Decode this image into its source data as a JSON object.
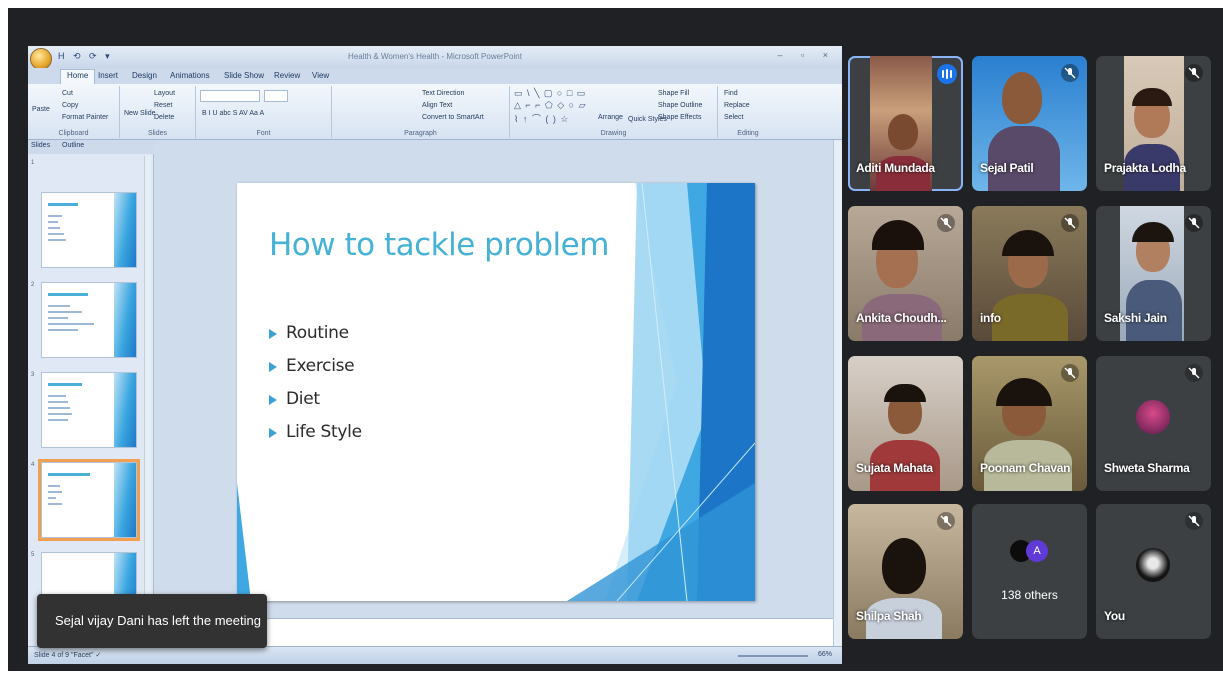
{
  "ppt": {
    "qat": "H ⟲ ⟳ ▾",
    "doc_title": "Health & Women's Health - Microsoft PowerPoint",
    "window_controls": "– ▫ ×",
    "tabs": [
      "Home",
      "Insert",
      "Design",
      "Animations",
      "Slide Show",
      "Review",
      "View"
    ],
    "ribbon": {
      "clipboard": {
        "label": "Clipboard",
        "paste": "Paste",
        "cut": "Cut",
        "copy": "Copy",
        "format_painter": "Format Painter"
      },
      "slides": {
        "label": "Slides",
        "new_slide": "New Slide",
        "layout": "Layout",
        "reset": "Reset",
        "delete": "Delete"
      },
      "font": {
        "label": "Font",
        "format_row": "B  I  U  abc  S  AV  Aa  A"
      },
      "paragraph": {
        "label": "Paragraph",
        "text_direction": "Text Direction",
        "align_text": "Align Text",
        "convert_smartart": "Convert to SmartArt"
      },
      "drawing": {
        "label": "Drawing",
        "shapes_row1": "▭ \\ ╲ ▢ ○ □ ▭",
        "shapes_row2": "△ ⌐ ⌐ ⬠ ◇ ○ ▱",
        "shapes_row3": "⌇ ↑ ⌒ ( ) ☆",
        "arrange": "Arrange",
        "quick_styles": "Quick Styles",
        "shape_fill": "Shape Fill",
        "shape_outline": "Shape Outline",
        "shape_effects": "Shape Effects"
      },
      "editing": {
        "label": "Editing",
        "find": "Find",
        "replace": "Replace",
        "select": "Select"
      }
    },
    "panel_tabs": [
      "Slides",
      "Outline"
    ],
    "thumb_numbers": [
      "1",
      "2",
      "3",
      "4",
      "5"
    ],
    "slide": {
      "title": "How to tackle problem",
      "bullets": [
        "Routine",
        "Exercise",
        "Diet",
        "Life Style"
      ]
    },
    "status": "Slide 4 of 9   \"Facet\"   ✓",
    "zoom": "66%"
  },
  "toast": "Sejal vijay Dani has left the meeting",
  "participants": [
    {
      "name": "Aditi Mundada",
      "speaking": true
    },
    {
      "name": "Sejal Patil",
      "muted": true
    },
    {
      "name": "Prajakta Lodha",
      "muted": true
    },
    {
      "name": "Ankita Choudh...",
      "muted": true
    },
    {
      "name": "info",
      "muted": true
    },
    {
      "name": "Sakshi Jain",
      "muted": true
    },
    {
      "name": "Sujata Mahata",
      "muted": false
    },
    {
      "name": "Poonam Chavan",
      "muted": true
    },
    {
      "name": "Shweta Sharma",
      "muted": true
    },
    {
      "name": "Shilpa Shah",
      "muted": true
    },
    {
      "name": "138 others",
      "avatar_letter": "A"
    },
    {
      "name": "You",
      "muted": true
    }
  ],
  "colors": {
    "meet_bg": "#202124",
    "tile_bg": "#3c4043",
    "accent_blue": "#1a73e8",
    "slide_title": "#45b2d6",
    "avatar_purple": "#5e3bd6"
  }
}
